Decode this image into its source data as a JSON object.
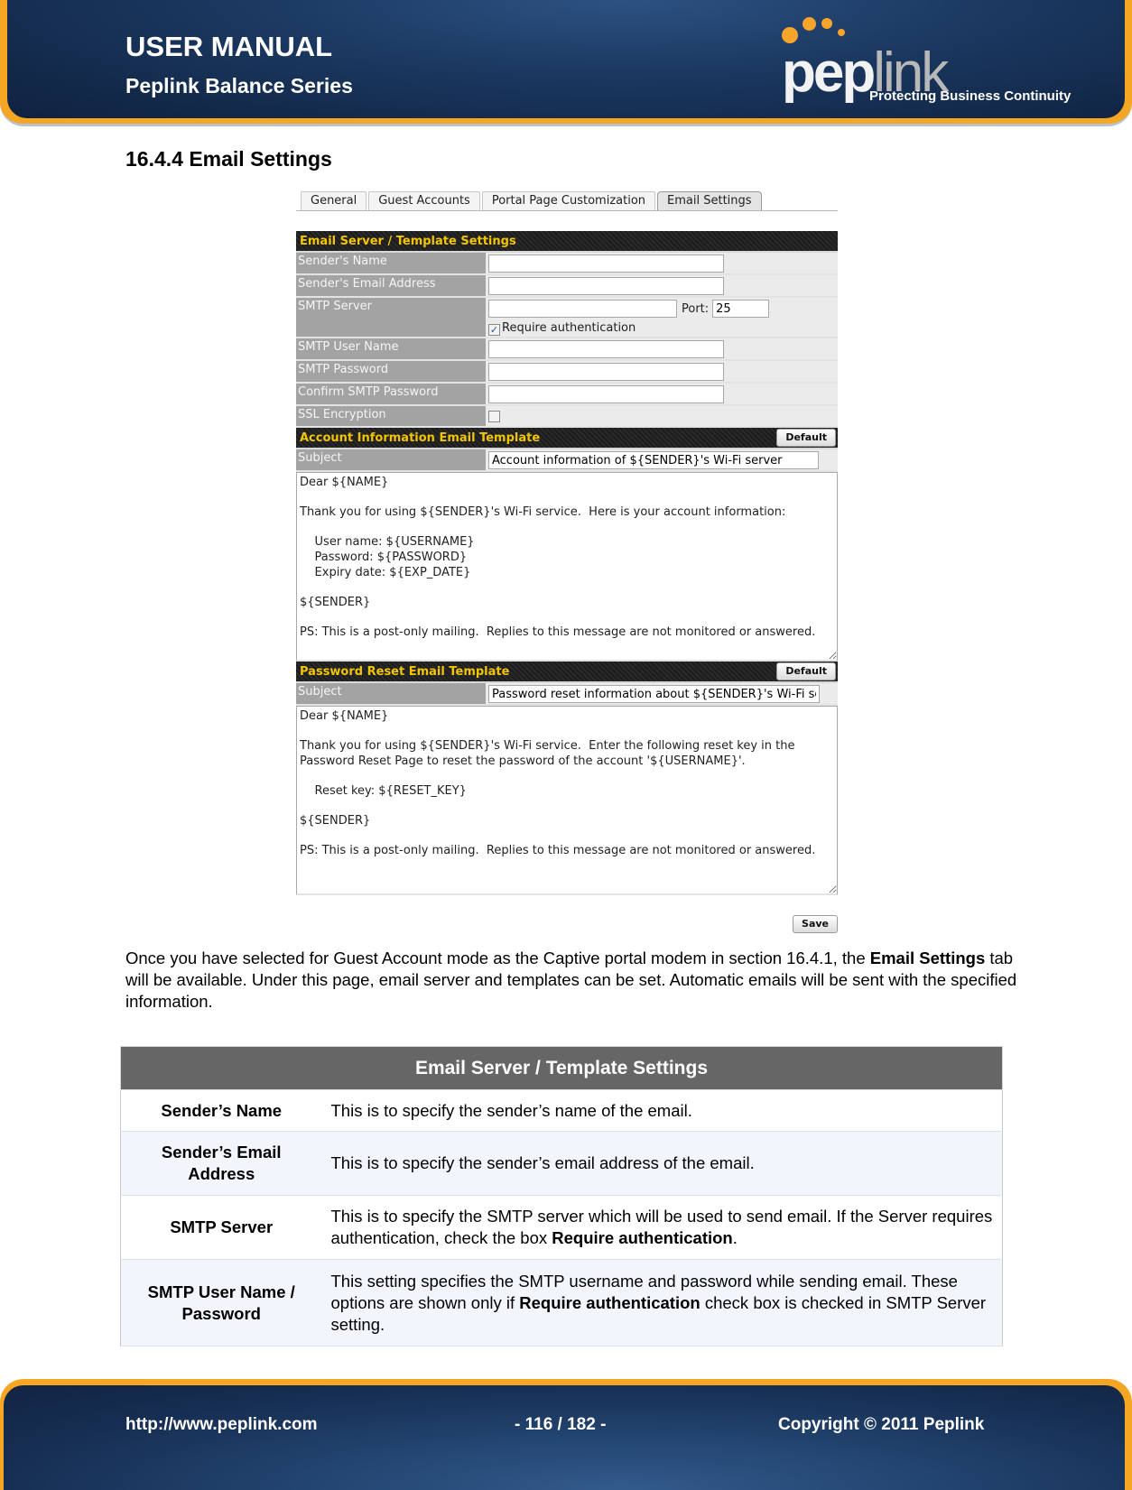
{
  "header": {
    "title": "USER MANUAL",
    "subtitle": "Peplink Balance Series",
    "logo": {
      "wordmark_primary": "pep",
      "wordmark_secondary": "link",
      "tagline": "Protecting Business Continuity",
      "accent_color": "#f7a42b"
    }
  },
  "section": {
    "title": "16.4.4 Email Settings"
  },
  "screenshot": {
    "tabs": [
      {
        "label": "General",
        "active": false
      },
      {
        "label": "Guest Accounts",
        "active": false
      },
      {
        "label": "Portal Page Customization",
        "active": false
      },
      {
        "label": "Email Settings",
        "active": true
      }
    ],
    "server_settings": {
      "header": "Email Server / Template Settings",
      "senders_name": {
        "label": "Sender's Name",
        "value": ""
      },
      "senders_email": {
        "label": "Sender's Email Address",
        "value": ""
      },
      "smtp_server": {
        "label": "SMTP Server",
        "value": "",
        "port_label": "Port:",
        "port_value": "25",
        "require_auth_label": "Require authentication",
        "require_auth_checked": true
      },
      "smtp_user": {
        "label": "SMTP User Name",
        "value": ""
      },
      "smtp_password": {
        "label": "SMTP Password",
        "value": ""
      },
      "confirm_password": {
        "label": "Confirm SMTP Password",
        "value": ""
      },
      "ssl": {
        "label": "SSL Encryption",
        "checked": false
      }
    },
    "account_template": {
      "header": "Account Information Email Template",
      "default_button": "Default",
      "subject_label": "Subject",
      "subject_value": "Account information of ${SENDER}'s Wi-Fi server",
      "body": "Dear ${NAME}\n\nThank you for using ${SENDER}'s Wi-Fi service.  Here is your account information:\n\n    User name: ${USERNAME}\n    Password: ${PASSWORD}\n    Expiry date: ${EXP_DATE}\n\n${SENDER}\n\nPS: This is a post-only mailing.  Replies to this message are not monitored or answered."
    },
    "reset_template": {
      "header": "Password Reset Email Template",
      "default_button": "Default",
      "subject_label": "Subject",
      "subject_value": "Password reset information about ${SENDER}'s Wi-Fi server",
      "body": "Dear ${NAME}\n\nThank you for using ${SENDER}'s Wi-Fi service.  Enter the following reset key in the Password Reset Page to reset the password of the account '${USERNAME}'.\n\n    Reset key: ${RESET_KEY}\n\n${SENDER}\n\nPS: This is a post-only mailing.  Replies to this message are not monitored or answered."
    },
    "save_button": "Save"
  },
  "paragraph": {
    "part1": "Once you have selected for Guest Account mode as the Captive portal modem in section 16.4.1, the ",
    "bold": "Email Settings",
    "part2": " tab will be available. Under this page, email server and templates can be set. Automatic emails will be sent with the specified information."
  },
  "table": {
    "title": "Email Server / Template Settings",
    "rows": [
      {
        "key": "Sender’s Name",
        "desc": "This is to specify the sender’s name of the email."
      },
      {
        "key": "Sender’s Email Address",
        "desc": "This is to specify the sender’s email address of the email."
      },
      {
        "key": "SMTP Server",
        "desc_pre": "This is to specify the SMTP server which will be used to send email. If the Server requires authentication, check the box ",
        "desc_bold": "Require authentication",
        "desc_post": "."
      },
      {
        "key": "SMTP User Name / Password",
        "desc_pre": "This setting specifies the SMTP username and password while sending email. These options are shown only if ",
        "desc_bold": "Require authentication",
        "desc_post": " check box is checked in SMTP Server setting."
      }
    ]
  },
  "footer": {
    "url": "http://www.peplink.com",
    "page": "- 116 / 182 -",
    "copyright": "Copyright © 2011 Peplink"
  }
}
